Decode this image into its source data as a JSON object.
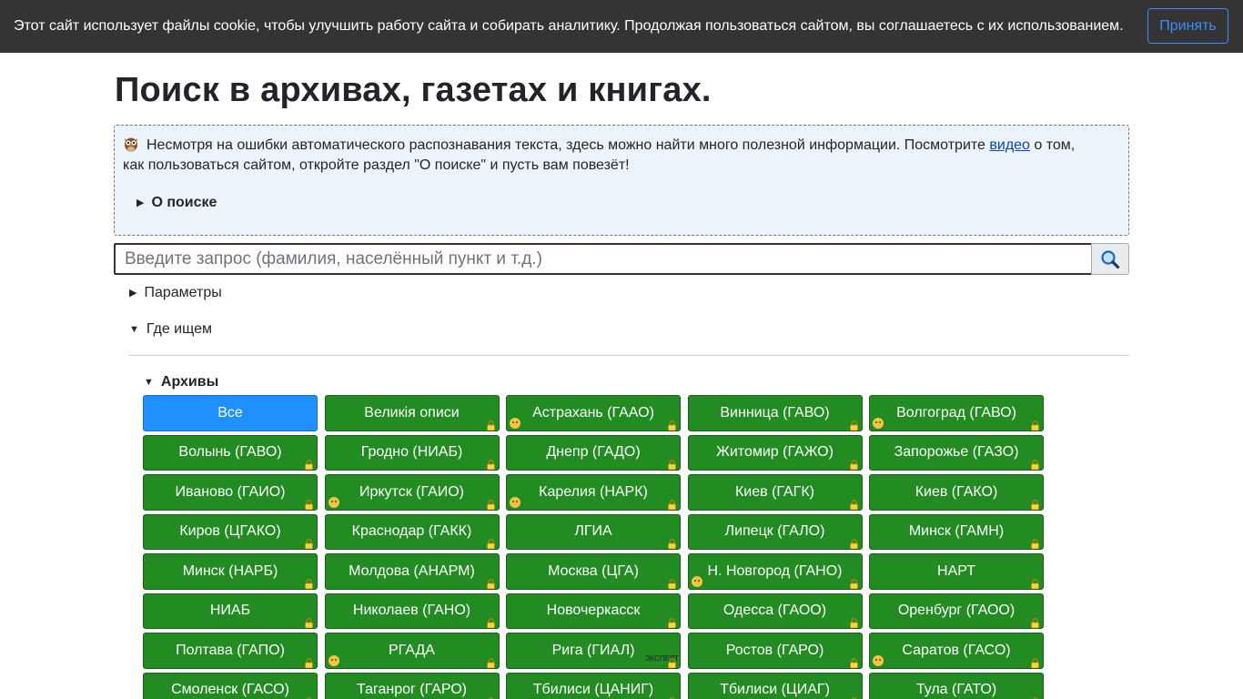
{
  "cookie": {
    "text": "Этот сайт использует файлы cookie, чтобы улучшить работу сайта и собирать аналитику. Продолжая пользоваться сайтом, вы соглашаетесь с их использованием.",
    "accept_label": "Принять"
  },
  "page": {
    "title": "Поиск в архивах, газетах и книгах."
  },
  "info": {
    "line1_before_link": "Несмотря на ошибки автоматического распознавания текста, здесь можно найти много полезной информации. Посмотрите ",
    "link_text": "видео",
    "line1_after_link": " о том,",
    "line2": "как пользоваться сайтом, откройте раздел \"О поиске\" и пусть вам повезёт!",
    "about_label": "О поиске",
    "icon": "owl-icon"
  },
  "search": {
    "placeholder": "Введите запрос (фамилия, населённый пункт и т.д.)",
    "value": "",
    "button_icon": "magnifier-icon"
  },
  "sections": {
    "params_label": "Параметры",
    "where_label": "Где ищем",
    "archives_label": "Архивы"
  },
  "archives": [
    {
      "label": "Все",
      "active": true,
      "lock": false,
      "sad": false,
      "expert": ""
    },
    {
      "label": "Великія описи",
      "active": false,
      "lock": true,
      "sad": false,
      "expert": ""
    },
    {
      "label": "Астрахань (ГААО)",
      "active": false,
      "lock": true,
      "sad": true,
      "expert": ""
    },
    {
      "label": "Винница (ГАВО)",
      "active": false,
      "lock": true,
      "sad": false,
      "expert": ""
    },
    {
      "label": "Волгоград (ГАВО)",
      "active": false,
      "lock": true,
      "sad": true,
      "expert": ""
    },
    {
      "label": "Волынь (ГАВО)",
      "active": false,
      "lock": true,
      "sad": false,
      "expert": ""
    },
    {
      "label": "Гродно (НИАБ)",
      "active": false,
      "lock": true,
      "sad": false,
      "expert": ""
    },
    {
      "label": "Днепр (ГАДО)",
      "active": false,
      "lock": true,
      "sad": false,
      "expert": ""
    },
    {
      "label": "Житомир (ГАЖО)",
      "active": false,
      "lock": true,
      "sad": false,
      "expert": ""
    },
    {
      "label": "Запорожье (ГАЗО)",
      "active": false,
      "lock": true,
      "sad": false,
      "expert": ""
    },
    {
      "label": "Иваново (ГАИО)",
      "active": false,
      "lock": true,
      "sad": false,
      "expert": ""
    },
    {
      "label": "Иркутск (ГАИО)",
      "active": false,
      "lock": true,
      "sad": true,
      "expert": ""
    },
    {
      "label": "Карелия (НАРК)",
      "active": false,
      "lock": true,
      "sad": true,
      "expert": ""
    },
    {
      "label": "Киев (ГАГК)",
      "active": false,
      "lock": true,
      "sad": false,
      "expert": ""
    },
    {
      "label": "Киев (ГАКО)",
      "active": false,
      "lock": true,
      "sad": false,
      "expert": ""
    },
    {
      "label": "Киров (ЦГАКО)",
      "active": false,
      "lock": true,
      "sad": false,
      "expert": ""
    },
    {
      "label": "Краснодар (ГАКК)",
      "active": false,
      "lock": true,
      "sad": false,
      "expert": ""
    },
    {
      "label": "ЛГИА",
      "active": false,
      "lock": true,
      "sad": false,
      "expert": ""
    },
    {
      "label": "Липецк (ГАЛО)",
      "active": false,
      "lock": true,
      "sad": false,
      "expert": ""
    },
    {
      "label": "Минск (ГАМН)",
      "active": false,
      "lock": true,
      "sad": false,
      "expert": ""
    },
    {
      "label": "Минск (НАРБ)",
      "active": false,
      "lock": true,
      "sad": false,
      "expert": ""
    },
    {
      "label": "Молдова (АНАРМ)",
      "active": false,
      "lock": true,
      "sad": false,
      "expert": ""
    },
    {
      "label": "Москва (ЦГА)",
      "active": false,
      "lock": true,
      "sad": false,
      "expert": ""
    },
    {
      "label": "Н. Новгород (ГАНО)",
      "active": false,
      "lock": true,
      "sad": true,
      "expert": ""
    },
    {
      "label": "НАРТ",
      "active": false,
      "lock": true,
      "sad": false,
      "expert": ""
    },
    {
      "label": "НИАБ",
      "active": false,
      "lock": true,
      "sad": false,
      "expert": ""
    },
    {
      "label": "Николаев (ГАНО)",
      "active": false,
      "lock": true,
      "sad": false,
      "expert": ""
    },
    {
      "label": "Новочеркасск",
      "active": false,
      "lock": true,
      "sad": false,
      "expert": ""
    },
    {
      "label": "Одесса (ГАОО)",
      "active": false,
      "lock": true,
      "sad": false,
      "expert": ""
    },
    {
      "label": "Оренбург (ГАОО)",
      "active": false,
      "lock": true,
      "sad": false,
      "expert": ""
    },
    {
      "label": "Полтава (ГАПО)",
      "active": false,
      "lock": true,
      "sad": false,
      "expert": ""
    },
    {
      "label": "РГАДА",
      "active": false,
      "lock": true,
      "sad": true,
      "expert": ""
    },
    {
      "label": "Рига (ГИАЛ)",
      "active": false,
      "lock": true,
      "sad": false,
      "expert": "ЭКСПЕРТ"
    },
    {
      "label": "Ростов (ГАРО)",
      "active": false,
      "lock": true,
      "sad": false,
      "expert": ""
    },
    {
      "label": "Саратов (ГАСО)",
      "active": false,
      "lock": true,
      "sad": true,
      "expert": ""
    },
    {
      "label": "Смоленск (ГАСО)",
      "active": false,
      "lock": true,
      "sad": false,
      "expert": ""
    },
    {
      "label": "Таганрог (ГАРО)",
      "active": false,
      "lock": true,
      "sad": false,
      "expert": ""
    },
    {
      "label": "Тбилиси (ЦАНИГ)",
      "active": false,
      "lock": true,
      "sad": false,
      "expert": ""
    },
    {
      "label": "Тбилиси (ЦИАГ)",
      "active": false,
      "lock": true,
      "sad": false,
      "expert": ""
    },
    {
      "label": "Тула (ГАТО)",
      "active": false,
      "lock": true,
      "sad": false,
      "expert": ""
    }
  ],
  "colors": {
    "archive_button": "#228b22",
    "archive_button_active": "#1e90ff",
    "info_bg": "#ecf3fb",
    "cookie_bg": "#343434",
    "accent": "#3d8bfd"
  }
}
